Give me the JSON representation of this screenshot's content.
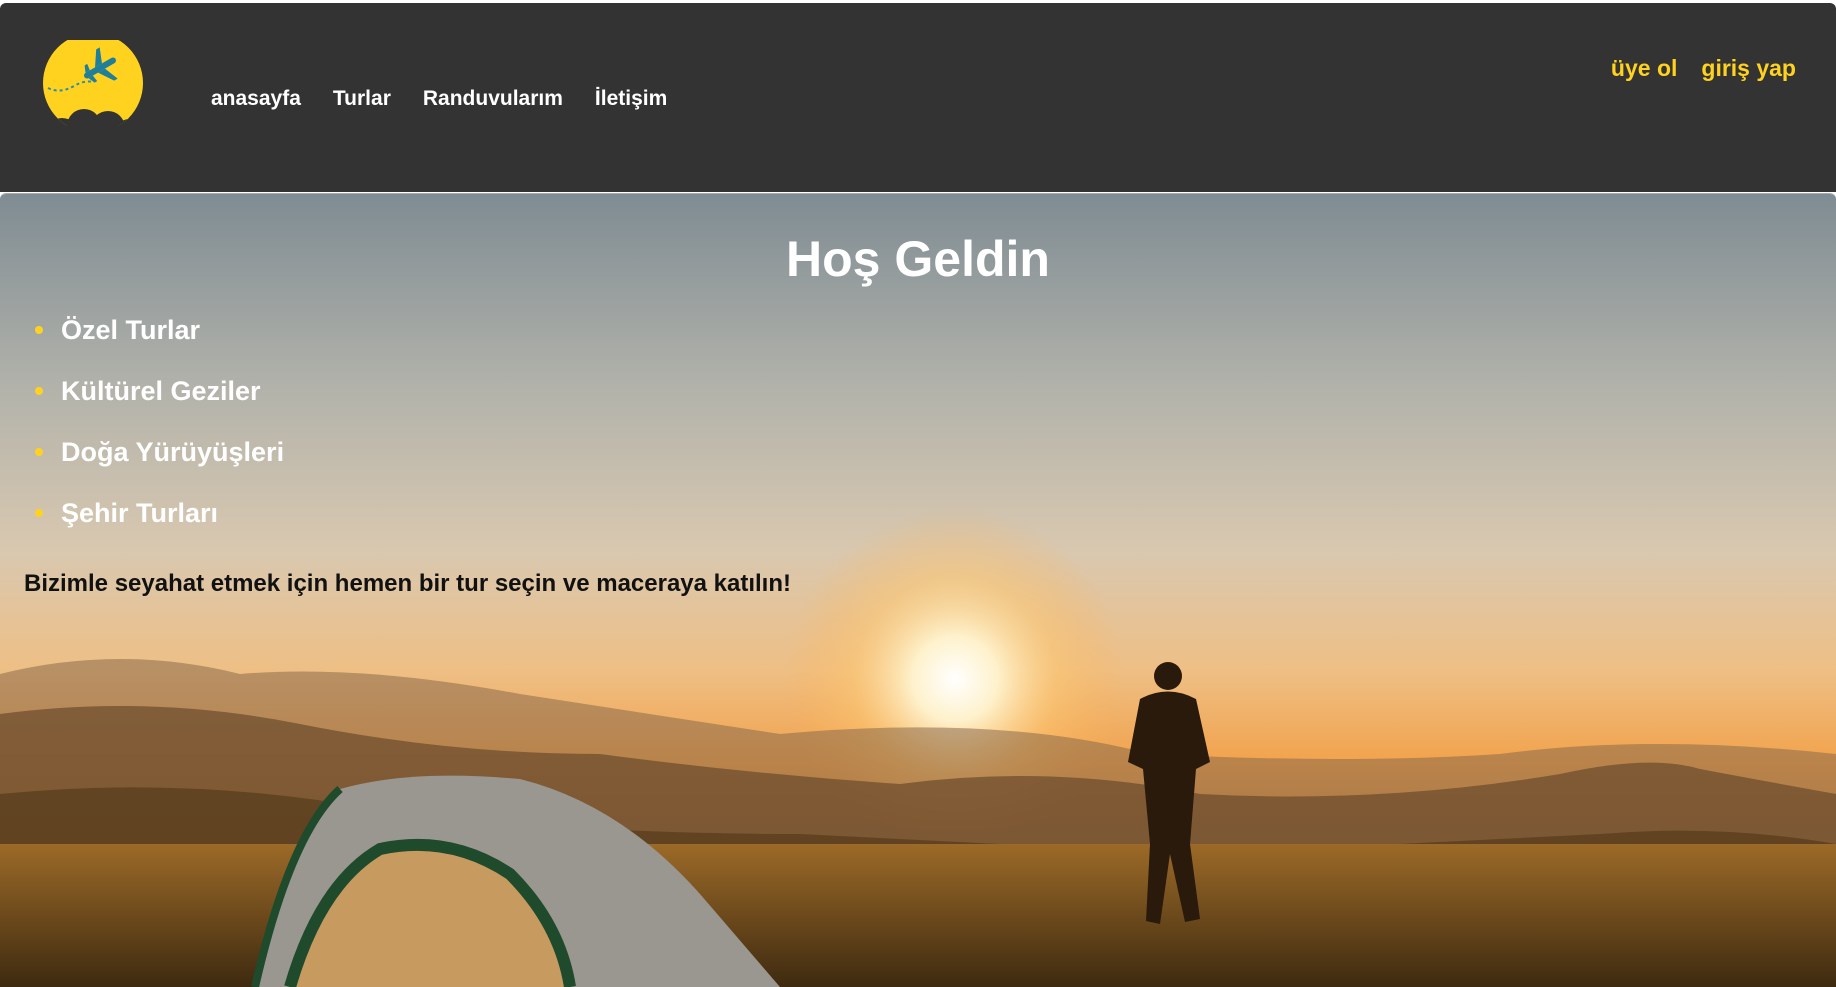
{
  "brand": {
    "logo_icon": "airplane-sun-logo",
    "accent_color": "#ffd21f"
  },
  "nav": {
    "items": [
      {
        "label": "anasayfa"
      },
      {
        "label": "Turlar"
      },
      {
        "label": "Randuvularım"
      },
      {
        "label": "İletişim"
      }
    ]
  },
  "auth": {
    "register_label": "üye ol",
    "login_label": "giriş yap"
  },
  "hero": {
    "title": "Hoş Geldin",
    "features": [
      {
        "label": "Özel Turlar"
      },
      {
        "label": "Kültürel Geziler"
      },
      {
        "label": "Doğa Yürüyüşleri"
      },
      {
        "label": "Şehir Turları"
      }
    ],
    "tagline": "Bizimle seyahat etmek için hemen bir tur seçin ve maceraya katılın!",
    "background": "sunrise-mountain-camping-photo"
  },
  "colors": {
    "header_bg": "#333333",
    "nav_text": "#ffffff",
    "auth_text": "#ffd21f"
  }
}
